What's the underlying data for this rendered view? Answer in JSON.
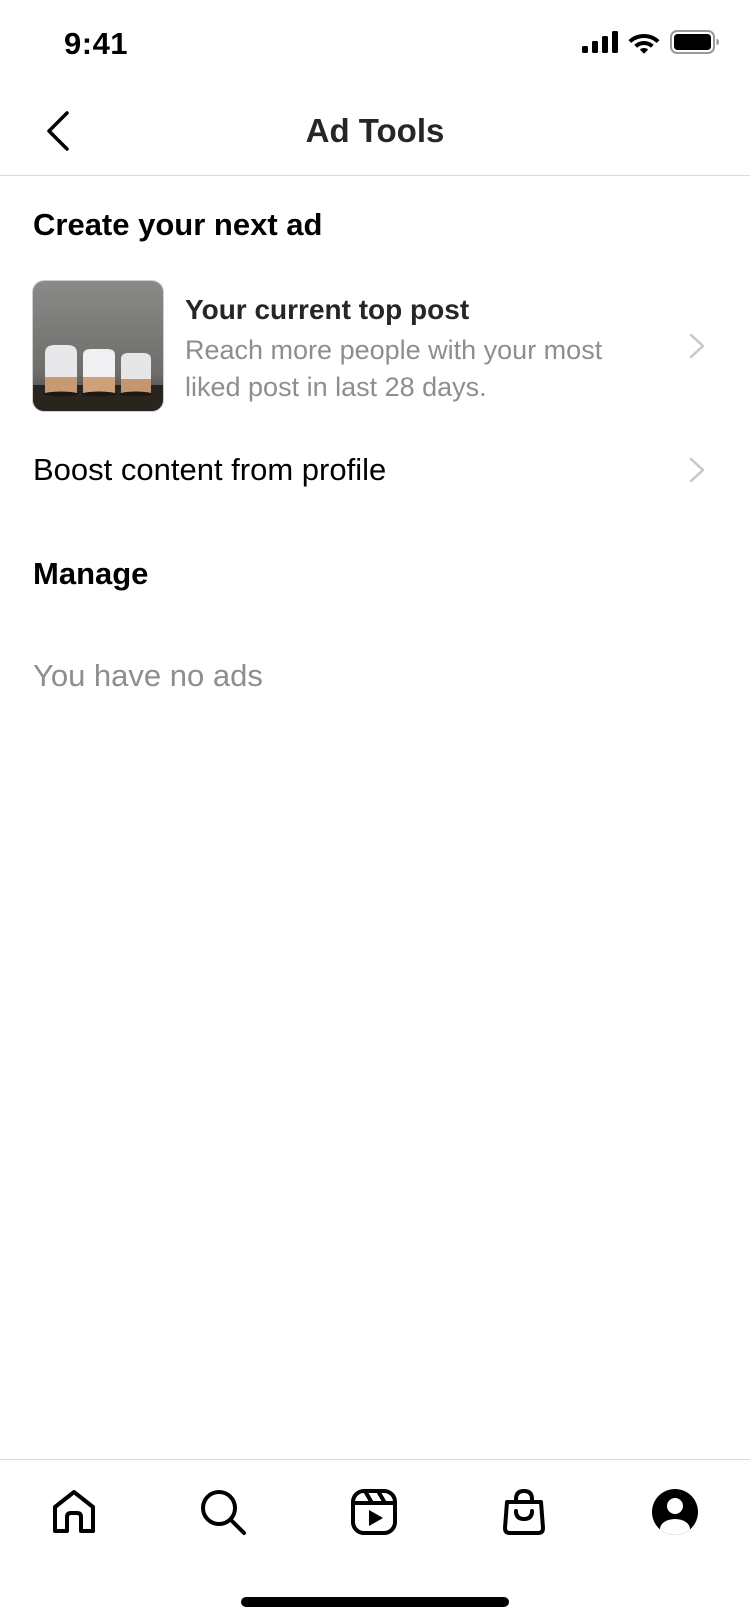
{
  "status_bar": {
    "time": "9:41",
    "icons": [
      "signal-icon",
      "wifi-icon",
      "battery-icon"
    ]
  },
  "header": {
    "title": "Ad Tools",
    "back_icon": "chevron-left-icon"
  },
  "create_section": {
    "title": "Create your next ad",
    "top_post": {
      "title": "Your current top post",
      "description": "Reach more people with your most liked post in last 28 days."
    },
    "boost_label": "Boost content from profile"
  },
  "manage_section": {
    "title": "Manage",
    "empty_text": "You have no ads"
  },
  "tab_bar": {
    "items": [
      "home-icon",
      "search-icon",
      "reels-icon",
      "shop-icon",
      "profile-icon"
    ]
  },
  "colors": {
    "primary_text": "#000000",
    "secondary_text": "#8e8e8e",
    "divider": "#dbdbdb",
    "chevron": "#c7c7c7"
  }
}
